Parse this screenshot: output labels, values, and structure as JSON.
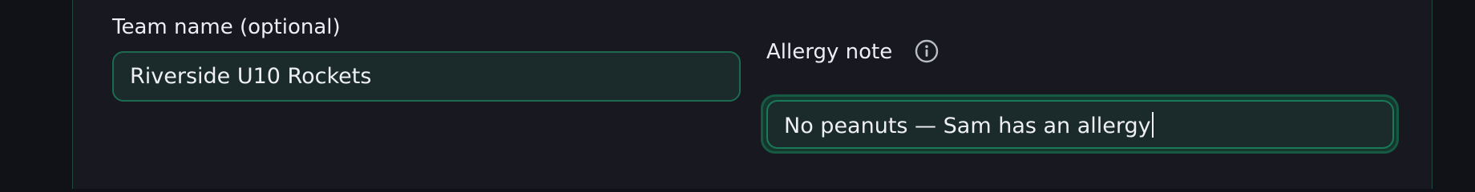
{
  "form": {
    "team_name": {
      "label": "Team name (optional)",
      "value": "Riverside U10 Rockets"
    },
    "allergy_note": {
      "label": "Allergy note",
      "value": "No peanuts — Sam has an allergy",
      "info_icon": "info-circle-icon"
    }
  },
  "colors": {
    "background": "#111218",
    "panel": "#171820",
    "field_fill": "#1b2a2b",
    "field_border": "#1c6b50",
    "text": "#eceef2"
  }
}
